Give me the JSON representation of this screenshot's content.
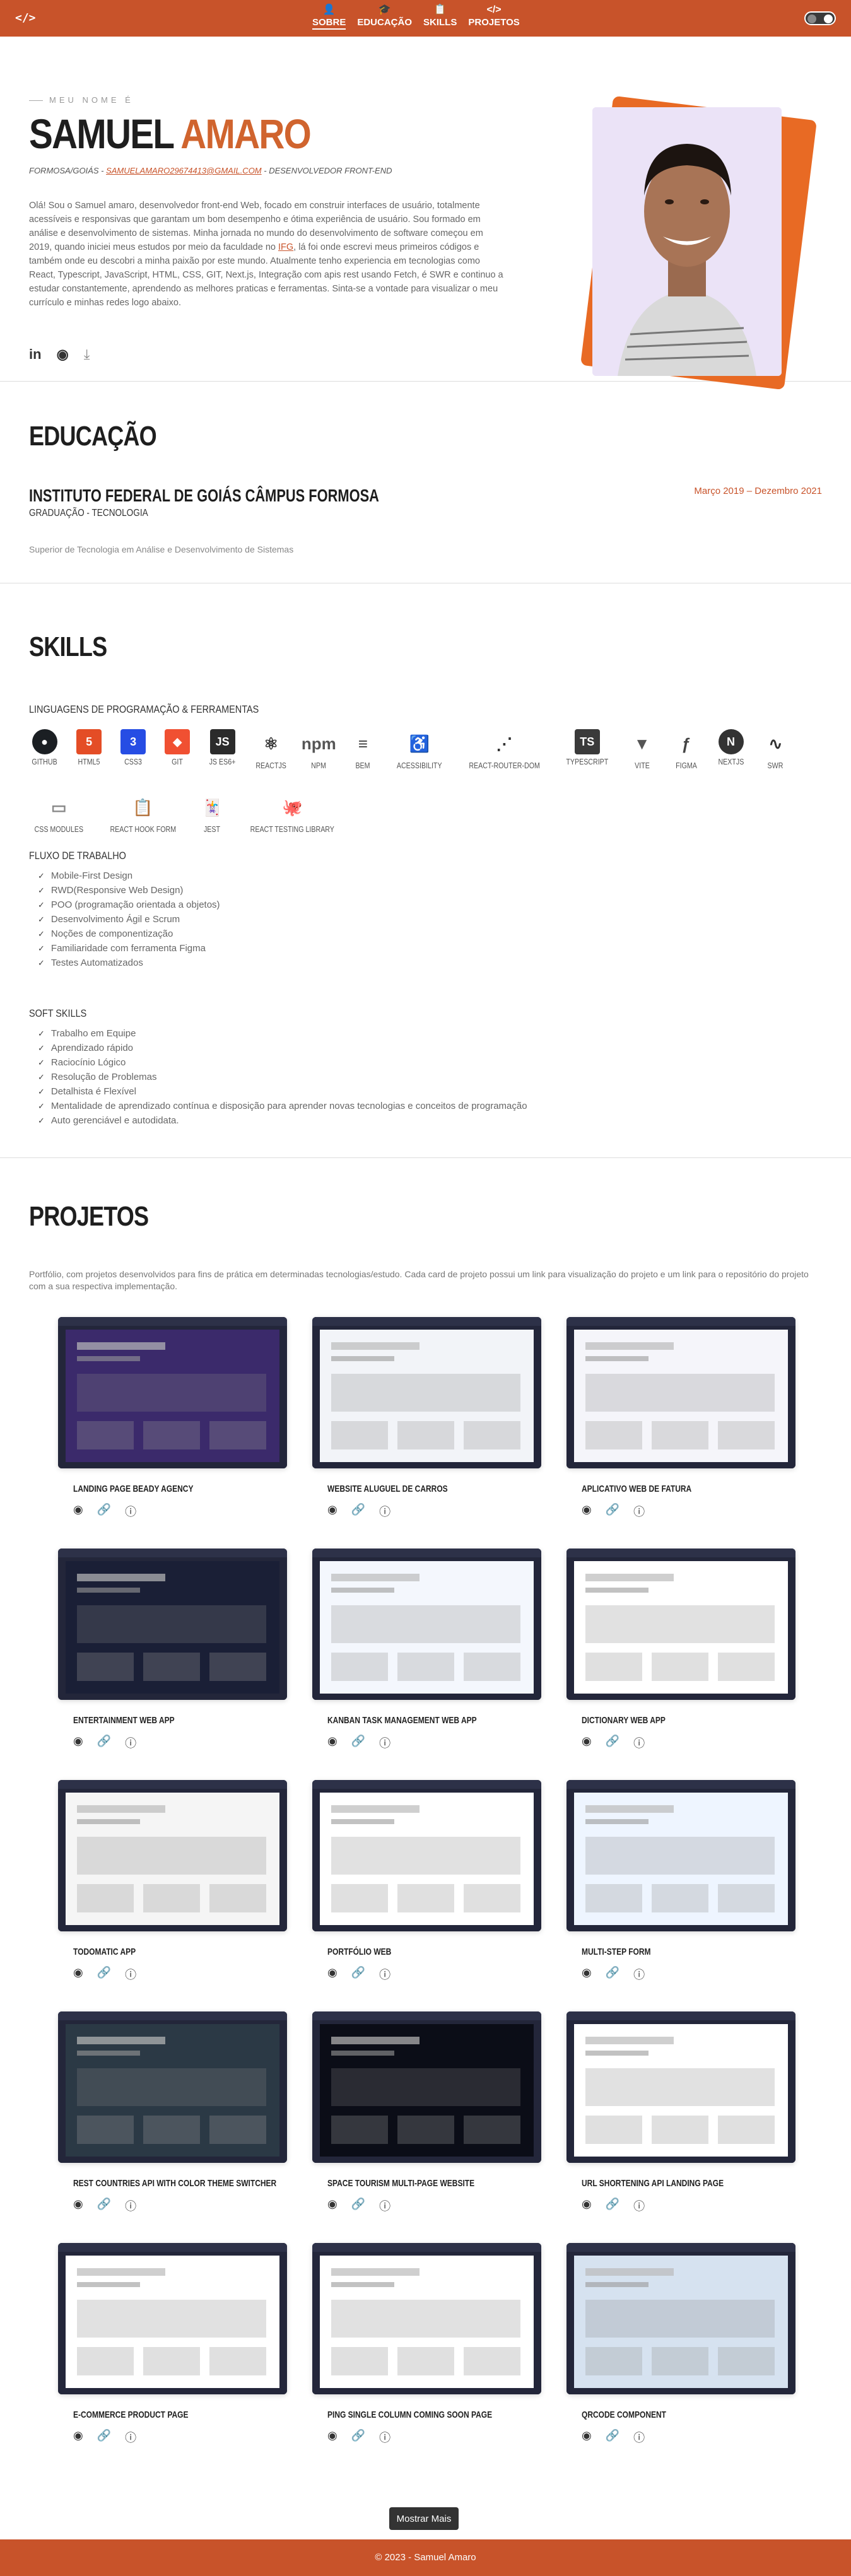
{
  "nav": {
    "logo": "</>",
    "links": [
      {
        "label": "Sobre",
        "icon": "👤"
      },
      {
        "label": "Educação",
        "icon": "🎓"
      },
      {
        "label": "Skills",
        "icon": "📋"
      },
      {
        "label": "Projetos",
        "icon": "</>"
      }
    ]
  },
  "about": {
    "kicker": "Meu nome é",
    "first_name": "Samuel",
    "last_name": "Amaro",
    "location": "Formosa/Goiás",
    "email": "samuelamaro29674413@gmail.com",
    "role": "Desenvolvedor Front-End",
    "bio_part1": "Olá! Sou o Samuel amaro, desenvolvedor front-end Web, focado em construir interfaces de usuário, totalmente acessíveis e responsivas que garantam um bom desempenho e ótima experiência de usuário. Sou formado em análise e desenvolvimento de sistemas. Minha jornada no mundo do desenvolvimento de software começou em 2019, quando iniciei meus estudos por meio da faculdade no ",
    "bio_link": "IFG",
    "bio_part2": ", lá foi onde escrevi meus primeiros códigos e também onde eu descobri a minha paixão por este mundo. Atualmente tenho experiencia em tecnologias como React, Typescript, JavaScript, HTML, CSS, GIT, Next.js, Integração com apis rest usando Fetch, é SWR e continuo a estudar constantemente, aprendendo as melhores praticas e ferramentas. Sinta-se a vontade para visualizar o meu currículo e minhas redes logo abaixo."
  },
  "education": {
    "title": "Educação",
    "institution": "Instituto Federal de Goiás Câmpus Formosa",
    "degree": "Graduação - Tecnologia",
    "dates": "Março 2019 – Dezembro 2021",
    "course": "Superior de Tecnologia em Análise e Desenvolvimento de Sistemas"
  },
  "skills": {
    "title": "Skills",
    "languages_heading": "Linguagens de programação & ferramentas",
    "techs": [
      {
        "label": "GITHUB",
        "icon": "github",
        "glyph": "●"
      },
      {
        "label": "HTML5",
        "icon": "html5",
        "glyph": "5"
      },
      {
        "label": "CSS3",
        "icon": "css3",
        "glyph": "3"
      },
      {
        "label": "GIT",
        "icon": "git",
        "glyph": "◆"
      },
      {
        "label": "JS ES6+",
        "icon": "js",
        "glyph": "JS"
      },
      {
        "label": "REACTJS",
        "icon": "react",
        "glyph": "⚛"
      },
      {
        "label": "NPM",
        "icon": "npm",
        "glyph": "npm"
      },
      {
        "label": "BEM",
        "icon": "bem",
        "glyph": "≡"
      },
      {
        "label": "ACESSIBILITY",
        "icon": "accessibility",
        "glyph": "♿"
      },
      {
        "label": "REACT-ROUTER-DOM",
        "icon": "react-router",
        "glyph": "⋰"
      },
      {
        "label": "TYPESCRIPT",
        "icon": "typescript",
        "glyph": "TS"
      },
      {
        "label": "VITE",
        "icon": "vite",
        "glyph": "▼"
      },
      {
        "label": "FIGMA",
        "icon": "figma",
        "glyph": "ƒ"
      },
      {
        "label": "NEXTJS",
        "icon": "nextjs",
        "glyph": "N"
      },
      {
        "label": "SWR",
        "icon": "swr",
        "glyph": "∿"
      },
      {
        "label": "CSS MODULES",
        "icon": "css-modules",
        "glyph": "▭"
      },
      {
        "label": "REACT HOOK FORM",
        "icon": "react-hook-form",
        "glyph": "📋"
      },
      {
        "label": "JEST",
        "icon": "jest",
        "glyph": "🃏"
      },
      {
        "label": "REACT TESTING LIBRARY",
        "icon": "testing-library",
        "glyph": "🐙"
      }
    ],
    "workflow_heading": "Fluxo de trabalho",
    "workflow": [
      "Mobile-First Design",
      "RWD(Responsive Web Design)",
      "POO (programação orientada a objetos)",
      "Desenvolvimento Ágil e Scrum",
      "Noções de componentização",
      "Familiaridade com ferramenta Figma",
      "Testes Automatizados"
    ],
    "soft_heading": "Soft Skills",
    "soft": [
      "Trabalho em Equipe",
      "Aprendizado rápido",
      "Raciocínio Lógico",
      "Resolução de Problemas",
      "Detalhista é Flexível",
      "Mentalidade de aprendizado contínua e disposição para aprender novas tecnologias e conceitos de programação",
      "Auto gerenciável e autodidata."
    ]
  },
  "projects": {
    "title": "Projetos",
    "intro": "Portfólio, com projetos desenvolvidos para fins de prática em determinadas tecnologias/estudo. Cada card de projeto possui um link para visualização do projeto e um link para o repositório do projeto com a sua respectiva implementação.",
    "items": [
      {
        "title": "Landing page beady agency",
        "bg": "#3b2a6b"
      },
      {
        "title": "Website aluguel de carros",
        "bg": "#f2f4f8"
      },
      {
        "title": "Aplicativo web de fatura",
        "bg": "#f5f5fa"
      },
      {
        "title": "Entertainment web app",
        "bg": "#1a1f36"
      },
      {
        "title": "Kanban task management web app",
        "bg": "#f4f7fd"
      },
      {
        "title": "Dictionary web app",
        "bg": "#ffffff"
      },
      {
        "title": "Todomatic app",
        "bg": "#f5f5f5"
      },
      {
        "title": "Portfólio web",
        "bg": "#ffffff"
      },
      {
        "title": "Multi-step form",
        "bg": "#eef5ff"
      },
      {
        "title": "REST Countries API with color theme switcher",
        "bg": "#2b3945"
      },
      {
        "title": "Space tourism multi-page website",
        "bg": "#0b0d17"
      },
      {
        "title": "URL shortening API landing page",
        "bg": "#ffffff"
      },
      {
        "title": "E-commerce product page",
        "bg": "#ffffff"
      },
      {
        "title": "Ping single column coming soon page",
        "bg": "#ffffff"
      },
      {
        "title": "QRcode component",
        "bg": "#d6e2f0"
      }
    ],
    "more_label": "Mostrar Mais"
  },
  "footer": {
    "text": "© 2023 - Samuel Amaro"
  }
}
